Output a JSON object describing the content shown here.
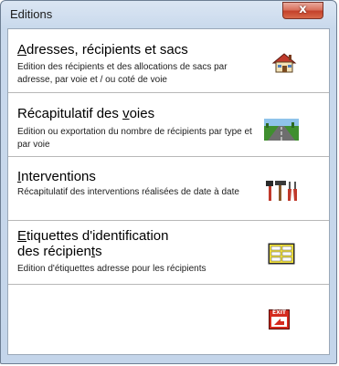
{
  "window": {
    "title": "Editions",
    "close_label": "x"
  },
  "items": [
    {
      "heading_first": "A",
      "heading_rest": "dresses, récipients et sacs",
      "desc": "Edition des récipients et des allocations de sacs par adresse, par voie et / ou coté de voie",
      "icon": "house-icon"
    },
    {
      "heading_pre": "Récapitulatif des ",
      "heading_ul": "v",
      "heading_post": "oies",
      "desc": "Edition ou exportation du nombre de récipients par type et par voie",
      "icon": "road-icon"
    },
    {
      "heading_first": "I",
      "heading_rest": "nterventions",
      "desc": "Récapitulatif des interventions réalisées de date à date",
      "icon": "tools-icon"
    },
    {
      "heading_first": "E",
      "heading_rest": "tiquettes d'identification",
      "heading_line2_pre": "des récipien",
      "heading_line2_ul": "t",
      "heading_line2_post": "s",
      "desc": "Edition d'étiquettes adresse pour les récipients",
      "icon": "labels-icon"
    }
  ],
  "exit": {
    "label": "EXIT",
    "icon": "exit-icon"
  }
}
